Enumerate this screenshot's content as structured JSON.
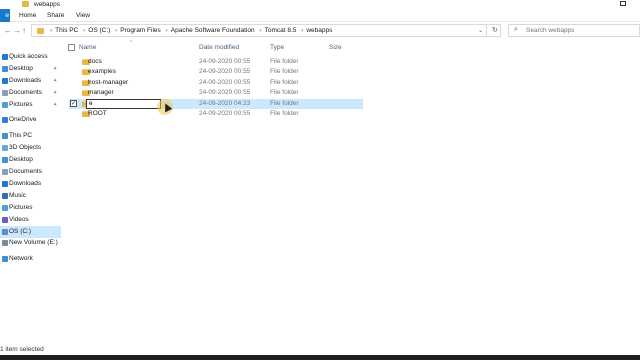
{
  "window": {
    "title": "webapps"
  },
  "ribbon": {
    "file_tab": "e",
    "tabs": [
      "Home",
      "Share",
      "View"
    ]
  },
  "address": {
    "crumbs": [
      "This PC",
      "OS (C:)",
      "Program Files",
      "Apache Software Foundation",
      "Tomcat 8.5",
      "webapps"
    ],
    "search_placeholder": "Search webapps"
  },
  "nav": {
    "items": [
      {
        "label": "Quick access",
        "icon": "star-icon",
        "color": "#1e78d6",
        "pinned": false
      },
      {
        "label": "Desktop",
        "icon": "desktop-icon",
        "color": "#3a8fd6",
        "pinned": true
      },
      {
        "label": "Downloads",
        "icon": "download-icon",
        "color": "#1e78d6",
        "pinned": true
      },
      {
        "label": "Documents",
        "icon": "documents-icon",
        "color": "#8aa0b8",
        "pinned": true
      },
      {
        "label": "Pictures",
        "icon": "pictures-icon",
        "color": "#4aa0d8",
        "pinned": true
      },
      {
        "label": "OneDrive",
        "icon": "cloud-icon",
        "color": "#2b7de0",
        "pinned": false
      },
      {
        "label": "This PC",
        "icon": "computer-icon",
        "color": "#3a8fd6",
        "pinned": false
      },
      {
        "label": "3D Objects",
        "icon": "cube-icon",
        "color": "#5fa8e0",
        "pinned": false
      },
      {
        "label": "Desktop",
        "icon": "desktop-icon",
        "color": "#3a8fd6",
        "pinned": false
      },
      {
        "label": "Documents",
        "icon": "documents-icon",
        "color": "#8aa0b8",
        "pinned": false
      },
      {
        "label": "Downloads",
        "icon": "download-icon",
        "color": "#1e78d6",
        "pinned": false
      },
      {
        "label": "Music",
        "icon": "music-icon",
        "color": "#2d6fb8",
        "pinned": false
      },
      {
        "label": "Pictures",
        "icon": "pictures-icon",
        "color": "#4aa0d8",
        "pinned": false
      },
      {
        "label": "Videos",
        "icon": "video-icon",
        "color": "#6a5acd",
        "pinned": false
      },
      {
        "label": "OS (C:)",
        "icon": "drive-icon",
        "color": "#5b8fc7",
        "pinned": false,
        "selected": true
      },
      {
        "label": "New Volume (E:)",
        "icon": "drive-icon",
        "color": "#7b8a99",
        "pinned": false
      },
      {
        "label": "Network",
        "icon": "network-icon",
        "color": "#3a8fd6",
        "pinned": false
      }
    ]
  },
  "columns": {
    "name": "Name",
    "date": "Date modified",
    "type": "Type",
    "size": "Size"
  },
  "files": [
    {
      "name": "docs",
      "date": "24-09-2020 00:55",
      "type": "File folder"
    },
    {
      "name": "examples",
      "date": "24-09-2020 00:55",
      "type": "File folder"
    },
    {
      "name": "host-manager",
      "date": "24-09-2020 00:55",
      "type": "File folder"
    },
    {
      "name": "manager",
      "date": "24-09-2020 00:55",
      "type": "File folder"
    },
    {
      "name": "",
      "date": "24-09-2020 04:23",
      "type": "File folder",
      "selected": true,
      "renaming": true,
      "rename_value": "e"
    },
    {
      "name": "ROOT",
      "date": "24-09-2020 00:55",
      "type": "File folder"
    }
  ],
  "status": {
    "text": "1 item selected"
  },
  "colors": {
    "accent": "#1979ca",
    "selection": "#cce8ff",
    "folder": "#e8b74a"
  }
}
